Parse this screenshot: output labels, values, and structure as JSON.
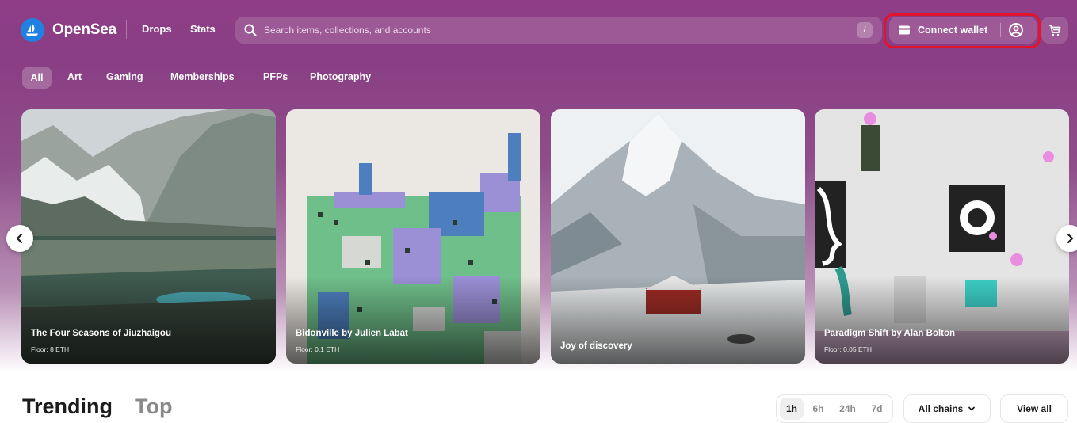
{
  "header": {
    "brand": "OpenSea",
    "nav": [
      "Drops",
      "Stats"
    ],
    "search_placeholder": "Search items, collections, and accounts",
    "search_shortcut": "/",
    "connect_wallet": "Connect wallet",
    "icons": [
      "opensea-logo-icon",
      "search-icon",
      "wallet-icon",
      "user-icon",
      "cart-icon"
    ]
  },
  "categories": [
    "All",
    "Art",
    "Gaming",
    "Memberships",
    "PFPs",
    "Photography"
  ],
  "selected_category": "All",
  "carousel": [
    {
      "title": "The Four Seasons of Jiuzhaigou",
      "floor": "Floor: 8 ETH"
    },
    {
      "title": "Bidonville by Julien Labat",
      "floor": "Floor: 0.1 ETH"
    },
    {
      "title": "Joy of discovery",
      "floor": ""
    },
    {
      "title": "Paradigm Shift by Alan Bolton",
      "floor": "Floor: 0.05 ETH"
    }
  ],
  "ranking": {
    "tabs": [
      "Trending",
      "Top"
    ],
    "active_tab": "Trending",
    "time_ranges": [
      "1h",
      "6h",
      "24h",
      "7d"
    ],
    "active_time_range": "1h",
    "chain_filter": "All chains",
    "view_all": "View all"
  },
  "colors": {
    "header_bg": "#8e3d86",
    "accent_blue": "#2081e2",
    "highlight_red": "#e0142c"
  }
}
